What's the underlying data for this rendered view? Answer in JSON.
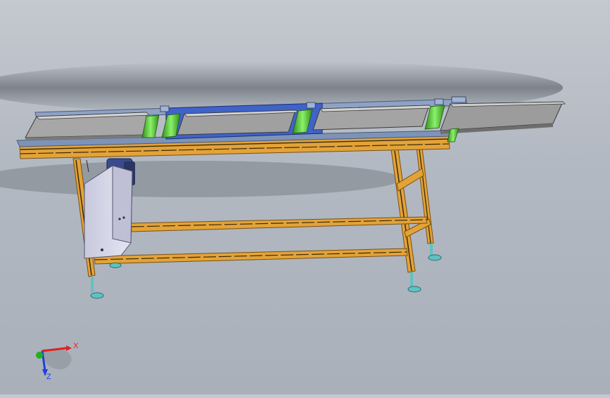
{
  "viewport": {
    "background_top": "#c4c9d0",
    "background_bottom": "#a9b0ba",
    "model": "roller-conveyor-assembly"
  },
  "colors": {
    "frame_profile": "#e3a338",
    "frame_profile_dark": "#8a5a16",
    "tray_gray": "#9a9a9a",
    "tray_light": "#bdbdbd",
    "rail_blue": "#3f63c9",
    "roller_green": "#5fd13a",
    "control_box": "#d2d2e4",
    "foot_teal": "#5fc2c2",
    "axis_x": "#e02020",
    "axis_y": "#20b020",
    "axis_z": "#2040e0"
  },
  "triad": {
    "x_label": "X",
    "z_label": "Z"
  }
}
